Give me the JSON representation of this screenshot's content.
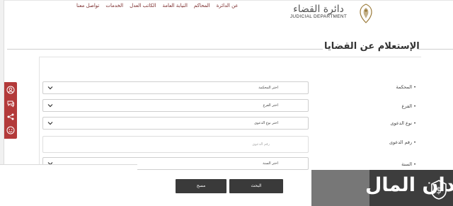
{
  "header": {
    "logo_arabic": "دائرة القضاء",
    "logo_english": "JUDICIAL DEPARTMENT",
    "nav": [
      "عن الدائرة",
      "المحاكم",
      "النيابة العامة",
      "الكاتب العدل",
      "الخدمات",
      "تواصل معنا"
    ]
  },
  "page": {
    "title": "الإستعلام عن القضايا"
  },
  "form": {
    "court_label": "• المحكمة",
    "court_value": "اختر المحكمة",
    "branch_label": "• الفرع",
    "branch_value": "اختر الفرع",
    "case_type_label": "• نوع الدعوى",
    "case_type_value": "اختر نوع الدعوى",
    "case_number_label": "• رقم الدعوى",
    "case_number_placeholder": "رقم الدعوى",
    "year_label": "• السنة",
    "year_value": "اختر السنة",
    "search_button": "البحث",
    "clear_button": "مسح"
  },
  "watermark": {
    "text": "ميدان المال"
  },
  "colors": {
    "accent": "#b33a3a",
    "nav_text": "#7a2a2a",
    "button": "#3a3a3a"
  }
}
